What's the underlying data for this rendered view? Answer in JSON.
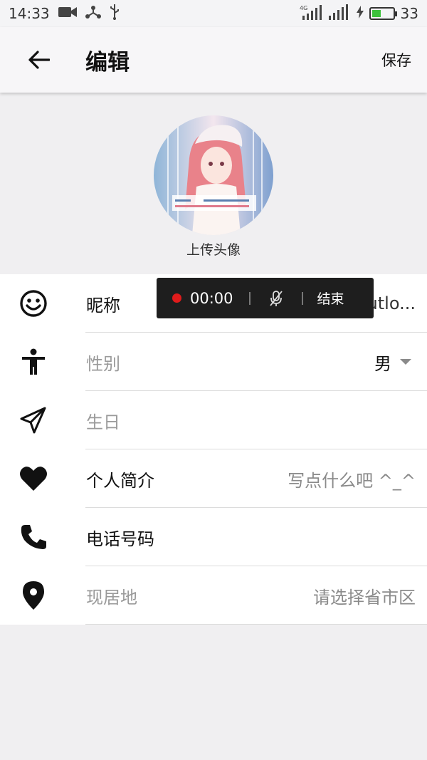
{
  "status_bar": {
    "time": "14:33",
    "network": "4G",
    "battery_level": "33"
  },
  "app_bar": {
    "title": "编辑",
    "save_label": "保存"
  },
  "avatar": {
    "upload_label": "上传头像"
  },
  "form": {
    "rows": [
      {
        "label": "昵称",
        "value": "metaphor@outlo...",
        "icon": "smiley-icon"
      },
      {
        "label": "性别",
        "value": "男",
        "icon": "person-icon"
      },
      {
        "label": "生日",
        "value": "",
        "icon": "send-icon"
      },
      {
        "label": "个人简介",
        "value": "写点什么吧 ^_^",
        "icon": "heart-icon"
      },
      {
        "label": "电话号码",
        "value": "",
        "icon": "phone-icon"
      },
      {
        "label": "现居地",
        "value": "请选择省市区",
        "icon": "location-pin-icon"
      }
    ]
  },
  "recording": {
    "time": "00:00",
    "end_label": "结束"
  },
  "colors": {
    "accent_red": "#e01b1b",
    "battery_green": "#3cc13c"
  }
}
